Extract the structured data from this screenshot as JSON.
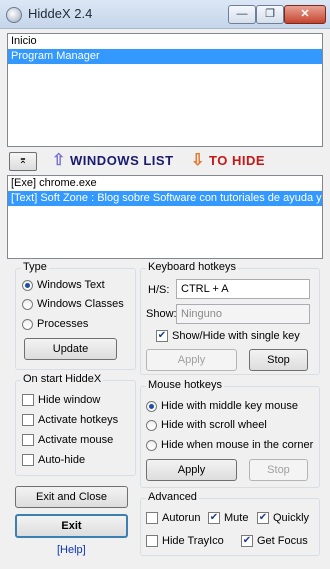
{
  "window": {
    "title": "HiddeX 2.4",
    "minimize_glyph": "—",
    "restore_glyph": "❐",
    "close_glyph": "✕"
  },
  "windows_list": {
    "items": [
      "Inicio",
      "Program Manager"
    ],
    "selected_index": 1
  },
  "banner": {
    "pin_glyph": "⌆",
    "windows_list_label": "WINDOWS LIST",
    "to_hide_label": "TO HIDE",
    "up_arrow": "⇧",
    "down_arrow": "⇩",
    "up_color": "#7b72d8",
    "down_color": "#e9732a"
  },
  "hide_list": {
    "items": [
      "[Exe] chrome.exe",
      "[Text] Soft Zone : Blog sobre Software con tutoriales de ayuda y"
    ],
    "selected_index": 1
  },
  "type_group": {
    "label": "Type",
    "options": [
      "Windows Text",
      "Windows Classes",
      "Processes"
    ],
    "selected": "Windows Text",
    "update_label": "Update"
  },
  "on_start": {
    "label": "On start HiddeX",
    "options": [
      {
        "label": "Hide window",
        "checked": false
      },
      {
        "label": "Activate hotkeys",
        "checked": false
      },
      {
        "label": "Activate mouse",
        "checked": false
      },
      {
        "label": "Auto-hide",
        "checked": false
      }
    ]
  },
  "actions": {
    "exit_close_label": "Exit and Close",
    "exit_label": "Exit",
    "help_label": "[Help]"
  },
  "keyboard": {
    "label": "Keyboard hotkeys",
    "hs_label": "H/S:",
    "hs_value": "CTRL + A",
    "show_label": "Show:",
    "show_value": "Ninguno",
    "single_key_label": "Show/Hide with single key",
    "single_key_checked": true,
    "apply_label": "Apply",
    "stop_label": "Stop"
  },
  "mouse": {
    "label": "Mouse hotkeys",
    "options": [
      "Hide with middle key mouse",
      "Hide with scroll wheel",
      "Hide when mouse in the corner"
    ],
    "selected": "Hide with middle key mouse",
    "apply_label": "Apply",
    "stop_label": "Stop"
  },
  "advanced": {
    "label": "Advanced",
    "options": [
      {
        "label": "Autorun",
        "checked": false
      },
      {
        "label": "Mute",
        "checked": true
      },
      {
        "label": "Quickly",
        "checked": true
      },
      {
        "label": "Hide TrayIco",
        "checked": false
      },
      {
        "label": "Get Focus",
        "checked": true
      }
    ]
  }
}
